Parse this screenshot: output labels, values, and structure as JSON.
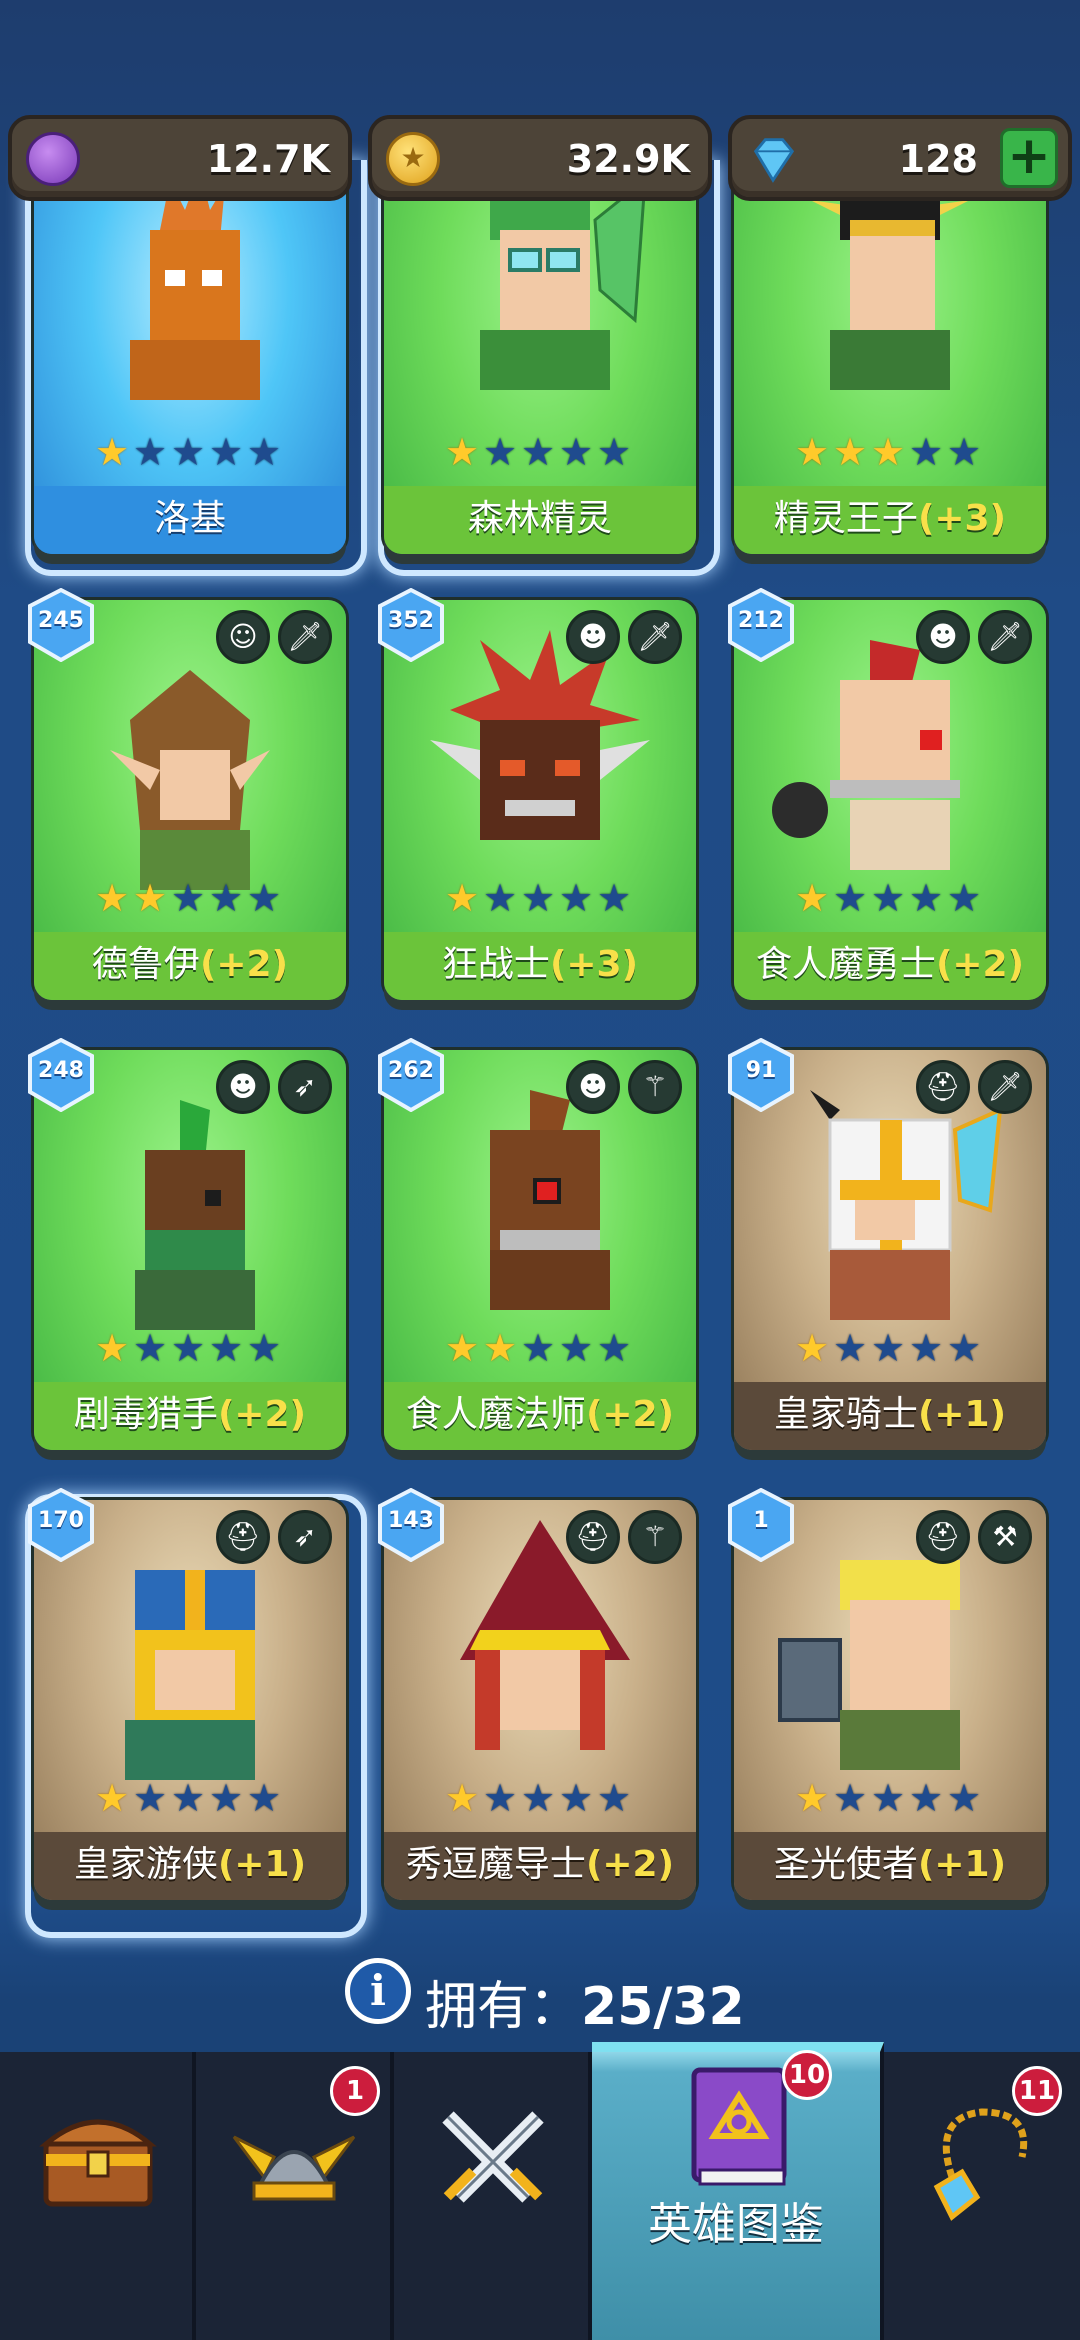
{
  "currency": {
    "purple": {
      "value": "12.7K",
      "icon": "purple-gem-icon"
    },
    "gold": {
      "value": "32.9K",
      "icon": "gold-coin-icon"
    },
    "diamond": {
      "value": "128",
      "icon": "diamond-icon"
    },
    "plus": "+"
  },
  "cards": [
    {
      "name": "洛基",
      "bonus": "",
      "stars": 1,
      "bg": "blue",
      "level": "",
      "classes": []
    },
    {
      "name": "森林精灵",
      "bonus": "",
      "stars": 1,
      "bg": "green",
      "level": "",
      "classes": []
    },
    {
      "name": "精灵王子",
      "bonus": "(+3)",
      "stars": 3,
      "bg": "green",
      "level": "",
      "classes": []
    },
    {
      "name": "德鲁伊",
      "bonus": "(+2)",
      "stars": 2,
      "bg": "green",
      "level": "245",
      "classes": [
        "elf-face-icon",
        "sword-icon"
      ]
    },
    {
      "name": "狂战士",
      "bonus": "(+3)",
      "stars": 1,
      "bg": "green",
      "level": "352",
      "classes": [
        "orc-face-icon",
        "sword-icon"
      ]
    },
    {
      "name": "食人魔勇士",
      "bonus": "(+2)",
      "stars": 1,
      "bg": "green",
      "level": "212",
      "classes": [
        "orc-face-icon",
        "sword-icon"
      ]
    },
    {
      "name": "剧毒猎手",
      "bonus": "(+2)",
      "stars": 1,
      "bg": "green",
      "level": "248",
      "classes": [
        "orc-face-icon",
        "bow-icon"
      ]
    },
    {
      "name": "食人魔法师",
      "bonus": "(+2)",
      "stars": 2,
      "bg": "green",
      "level": "262",
      "classes": [
        "orc-face-icon",
        "wand-icon"
      ]
    },
    {
      "name": "皇家骑士",
      "bonus": "(+1)",
      "stars": 1,
      "bg": "brown",
      "level": "91",
      "classes": [
        "helmet-icon",
        "sword-icon"
      ]
    },
    {
      "name": "皇家游侠",
      "bonus": "(+1)",
      "stars": 1,
      "bg": "brown",
      "level": "170",
      "classes": [
        "helmet-icon",
        "bow-icon"
      ]
    },
    {
      "name": "秀逗魔导士",
      "bonus": "(+2)",
      "stars": 1,
      "bg": "brown",
      "level": "143",
      "classes": [
        "helmet-icon",
        "wand-icon"
      ]
    },
    {
      "name": "圣光使者",
      "bonus": "(+1)",
      "stars": 1,
      "bg": "brown",
      "level": "1",
      "classes": [
        "helmet-icon",
        "hammer-icon"
      ]
    }
  ],
  "owned": {
    "label": "拥有：",
    "value": "25/32"
  },
  "nav": [
    {
      "icon": "treasure-chest-icon",
      "label": "",
      "badge": ""
    },
    {
      "icon": "winged-helmet-icon",
      "label": "",
      "badge": "1"
    },
    {
      "icon": "crossed-swords-icon",
      "label": "",
      "badge": ""
    },
    {
      "icon": "hero-book-icon",
      "label": "英雄图鉴",
      "badge": "10"
    },
    {
      "icon": "amulet-icon",
      "label": "",
      "badge": "11"
    }
  ]
}
